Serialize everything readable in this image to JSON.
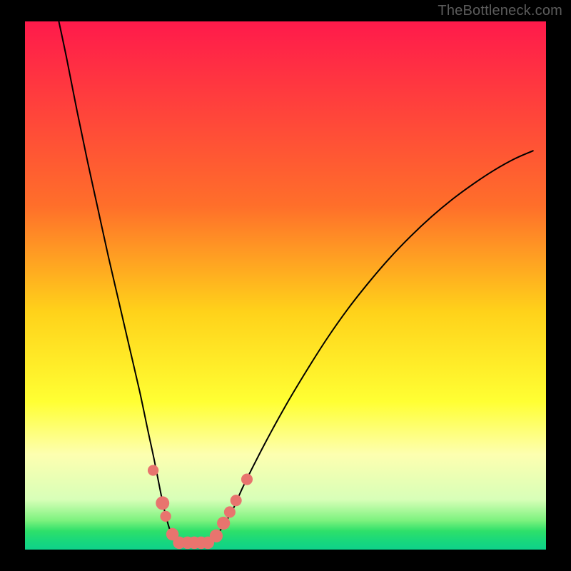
{
  "watermark": "TheBottleneck.com",
  "chart_data": {
    "type": "line",
    "title": "",
    "xlabel": "",
    "ylabel": "",
    "xlim": [
      0,
      100
    ],
    "ylim": [
      0,
      100
    ],
    "background_gradient": {
      "stops": [
        {
          "offset": 0.0,
          "color": "#ff1a4b"
        },
        {
          "offset": 0.35,
          "color": "#ff6f2a"
        },
        {
          "offset": 0.55,
          "color": "#ffd21a"
        },
        {
          "offset": 0.72,
          "color": "#ffff33"
        },
        {
          "offset": 0.82,
          "color": "#fdffb0"
        },
        {
          "offset": 0.905,
          "color": "#d8ffb8"
        },
        {
          "offset": 0.945,
          "color": "#7cf27e"
        },
        {
          "offset": 0.965,
          "color": "#2ee06a"
        },
        {
          "offset": 0.985,
          "color": "#17d77d"
        },
        {
          "offset": 1.0,
          "color": "#0fd18a"
        }
      ]
    },
    "series": [
      {
        "name": "left-branch",
        "x": [
          6.5,
          8,
          10,
          12,
          14,
          16,
          18,
          20,
          22,
          23.6,
          24.8,
          26,
          27,
          28,
          29
        ],
        "y": [
          100,
          93,
          83,
          73.5,
          64.5,
          55.5,
          47,
          38.5,
          30,
          22.5,
          17,
          11,
          6.5,
          3.2,
          1.3
        ]
      },
      {
        "name": "right-branch",
        "x": [
          35.5,
          37,
          38.5,
          40,
          42,
          46,
          50,
          54,
          58,
          62,
          66,
          70,
          74,
          78,
          82,
          86,
          90,
          94,
          97.5
        ],
        "y": [
          1.3,
          3.0,
          5.2,
          7.8,
          12.2,
          20.0,
          27.2,
          33.8,
          40.0,
          45.6,
          50.6,
          55.2,
          59.3,
          63.0,
          66.3,
          69.2,
          71.8,
          74.0,
          75.5
        ]
      }
    ],
    "flat_bottom": {
      "x_from": 29,
      "x_to": 35.5,
      "y": 1.3
    },
    "markers": [
      {
        "x": 24.6,
        "y": 15.0,
        "r": 1.05
      },
      {
        "x": 26.4,
        "y": 8.8,
        "r": 1.3
      },
      {
        "x": 27.0,
        "y": 6.3,
        "r": 1.05
      },
      {
        "x": 28.3,
        "y": 2.9,
        "r": 1.2
      },
      {
        "x": 29.6,
        "y": 1.3,
        "r": 1.2
      },
      {
        "x": 31.2,
        "y": 1.3,
        "r": 1.2
      },
      {
        "x": 32.5,
        "y": 1.3,
        "r": 1.2
      },
      {
        "x": 33.8,
        "y": 1.3,
        "r": 1.2
      },
      {
        "x": 35.1,
        "y": 1.3,
        "r": 1.2
      },
      {
        "x": 36.7,
        "y": 2.6,
        "r": 1.25
      },
      {
        "x": 38.1,
        "y": 5.0,
        "r": 1.25
      },
      {
        "x": 39.3,
        "y": 7.1,
        "r": 1.1
      },
      {
        "x": 40.5,
        "y": 9.3,
        "r": 1.1
      },
      {
        "x": 42.6,
        "y": 13.3,
        "r": 1.1
      }
    ],
    "marker_color": "#e8746e",
    "curve_color": "#000000",
    "curve_width": 2.0
  }
}
